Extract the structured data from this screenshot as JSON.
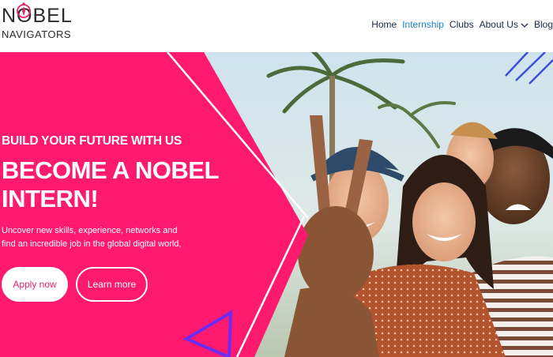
{
  "brand": {
    "logo_line1": "NOBEL",
    "logo_line2": "NAVIGATORS",
    "accent": "#ff1a70",
    "nav_text": "#1d2a4a",
    "nav_active": "#1f7fc2"
  },
  "nav": {
    "items": [
      {
        "label": "Home",
        "active": false
      },
      {
        "label": "Internship",
        "active": true
      },
      {
        "label": "Clubs",
        "active": false
      },
      {
        "label": "About Us",
        "active": false,
        "dropdown": true
      },
      {
        "label": "Blog",
        "active": false
      }
    ],
    "dropdown_icon": "chevron-down-icon"
  },
  "hero": {
    "eyebrow": "BUILD YOUR FUTURE WITH US",
    "headline_line1": "BECOME A NOBEL",
    "headline_line2": "INTERN!",
    "subtitle_line1": "Uncover new skills, experience, networks and",
    "subtitle_line2": "find an incredible job in the global digital world,",
    "apply_label": "Apply now",
    "learn_label": "Learn more",
    "image": "group-of-smiling-young-people-photo"
  }
}
